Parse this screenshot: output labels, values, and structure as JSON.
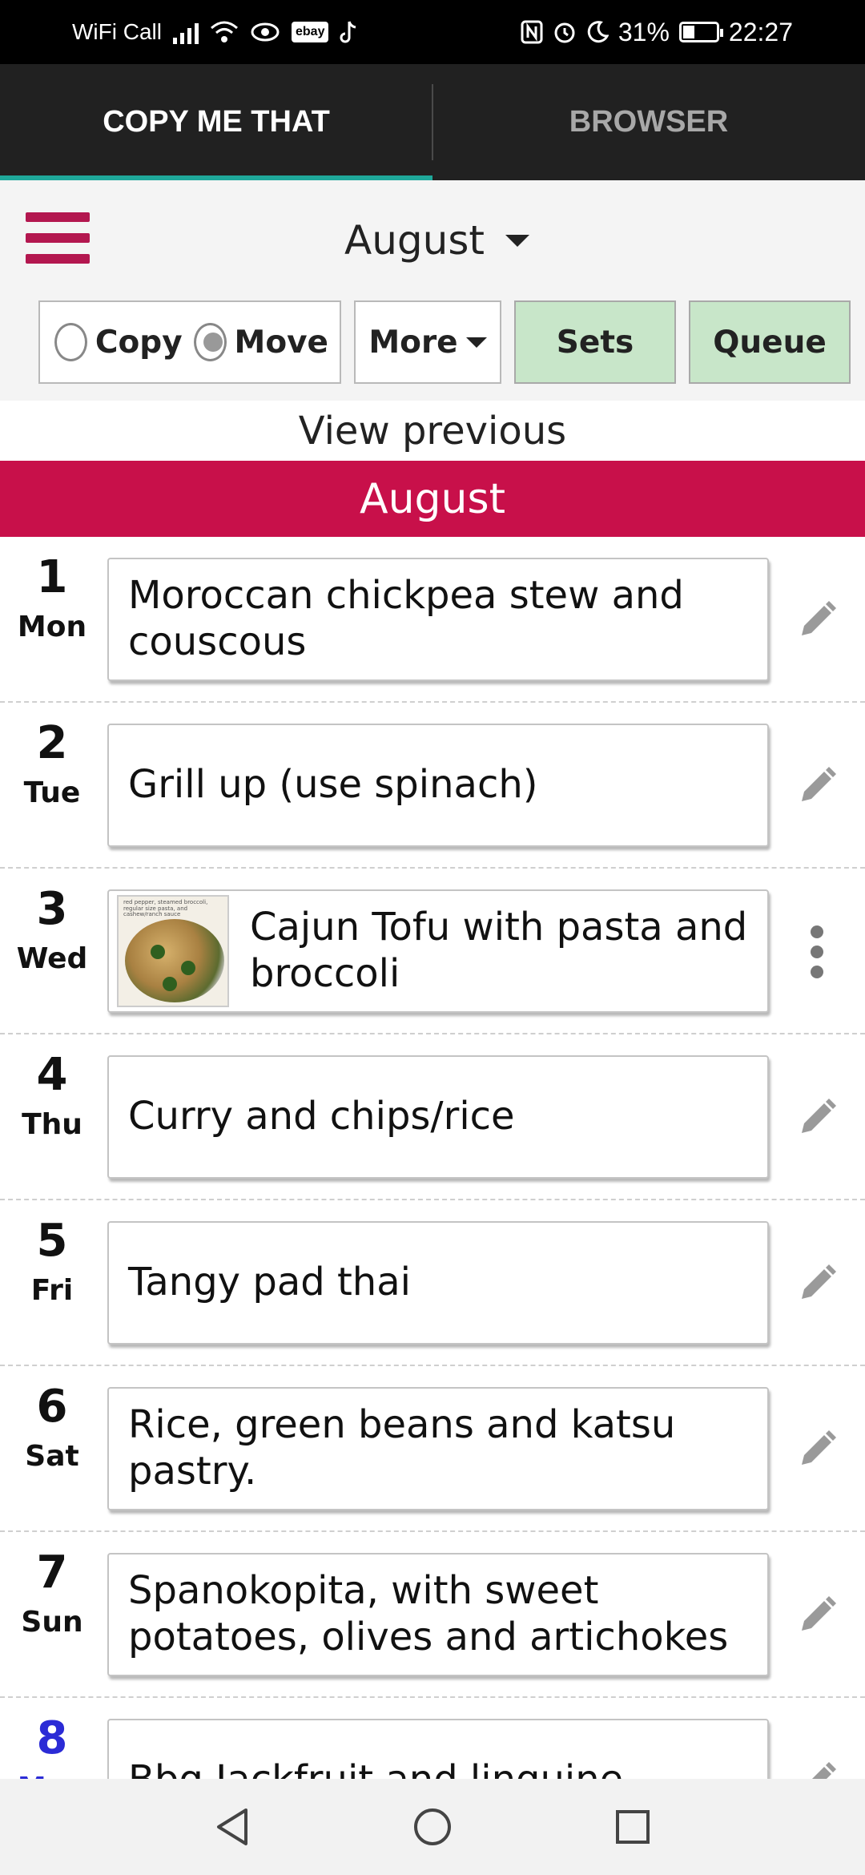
{
  "status_bar": {
    "carrier": "WiFi Call",
    "battery_percent": "31%",
    "time": "22:27",
    "ebay_label": "ebay"
  },
  "tabs": [
    {
      "label": "COPY ME THAT",
      "active": true
    },
    {
      "label": "BROWSER",
      "active": false
    }
  ],
  "header": {
    "month_select": "August"
  },
  "toolbar": {
    "copy_label": "Copy",
    "move_label": "Move",
    "selected_mode": "Move",
    "more_label": "More",
    "sets_label": "Sets",
    "queue_label": "Queue"
  },
  "view_previous": "View previous",
  "month_banner": "August",
  "days": [
    {
      "num": "1",
      "name": "Mon",
      "meal": "Moroccan chickpea stew and couscous",
      "action": "pencil-icon"
    },
    {
      "num": "2",
      "name": "Tue",
      "meal": "Grill up (use spinach)",
      "action": "pencil-icon"
    },
    {
      "num": "3",
      "name": "Wed",
      "meal": "Cajun Tofu with pasta and broccoli",
      "action": "kebab-menu-icon",
      "thumbnail_caption": "red pepper, steamed broccoli, regular size pasta, and cashew/ranch sauce"
    },
    {
      "num": "4",
      "name": "Thu",
      "meal": "Curry and chips/rice",
      "action": "pencil-icon"
    },
    {
      "num": "5",
      "name": "Fri",
      "meal": "Tangy pad thai",
      "action": "pencil-icon"
    },
    {
      "num": "6",
      "name": "Sat",
      "meal": "Rice, green beans and katsu pastry.",
      "action": "pencil-icon"
    },
    {
      "num": "7",
      "name": "Sun",
      "meal": "Spanokopita, with sweet potatoes, olives and artichokes",
      "action": "pencil-icon"
    },
    {
      "num": "8",
      "name": "Mon",
      "meal": "Bbq Jackfruit and linguine",
      "action": "pencil-icon",
      "today": true
    }
  ],
  "colors": {
    "accent": "#c8104a",
    "tab_indicator": "#1fa89a",
    "green_button": "#c8e6c9",
    "today": "#2b2bd6"
  }
}
